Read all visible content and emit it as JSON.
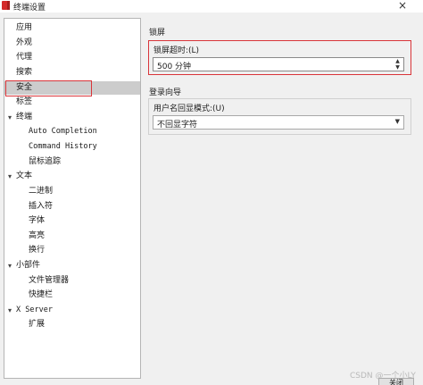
{
  "window": {
    "title": "终端设置",
    "close_glyph": "×"
  },
  "sidebar": {
    "items": [
      {
        "label": "应用",
        "expandable": false
      },
      {
        "label": "外观",
        "expandable": false
      },
      {
        "label": "代理",
        "expandable": false
      },
      {
        "label": "搜索",
        "expandable": false
      },
      {
        "label": "安全",
        "expandable": false,
        "selected": true
      },
      {
        "label": "标签",
        "expandable": false
      },
      {
        "label": "终端",
        "expandable": true,
        "expanded": true,
        "arrow": "▾"
      },
      {
        "label": "Auto Completion",
        "child_of": "终端"
      },
      {
        "label": "Command History",
        "child_of": "终端"
      },
      {
        "label": "鼠标追踪",
        "child_of": "终端"
      },
      {
        "label": "文本",
        "expandable": true,
        "expanded": true,
        "arrow": "▾"
      },
      {
        "label": "二进制",
        "child_of": "文本"
      },
      {
        "label": "插入符",
        "child_of": "文本"
      },
      {
        "label": "字体",
        "child_of": "文本"
      },
      {
        "label": "高亮",
        "child_of": "文本"
      },
      {
        "label": "换行",
        "child_of": "文本"
      },
      {
        "label": "小部件",
        "expandable": true,
        "expanded": true,
        "arrow": "▾"
      },
      {
        "label": "文件管理器",
        "child_of": "小部件"
      },
      {
        "label": "快捷栏",
        "child_of": "小部件"
      },
      {
        "label": "X Server",
        "expandable": true,
        "expanded": true,
        "arrow": "▾"
      },
      {
        "label": "扩展",
        "child_of": "X Server"
      }
    ]
  },
  "lock": {
    "section_title": "锁屏",
    "timeout_label": "锁屏超时:(L)",
    "timeout_value": "500 分钟",
    "spin_up": "▲",
    "spin_down": "▼"
  },
  "login": {
    "section_title": "登录向导",
    "echo_label": "用户名回显模式:(U)",
    "echo_value": "不回显字符",
    "dropdown_arrow": "▼"
  },
  "footer": {
    "watermark": "CSDN @一个小LY",
    "button_label": "关闭"
  },
  "colors": {
    "highlight_red": "#d9353a",
    "selected_bg": "#cccccc",
    "window_bg": "#f0f0f0"
  }
}
